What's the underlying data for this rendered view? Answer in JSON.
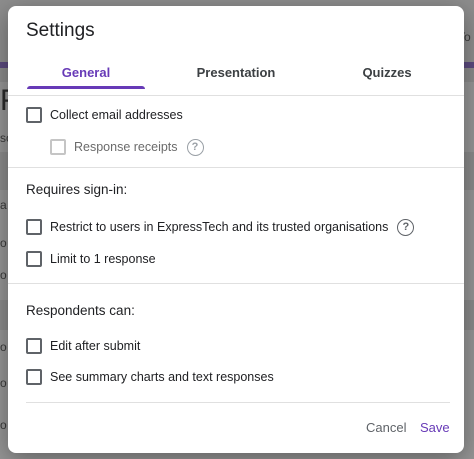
{
  "dialog": {
    "title": "Settings",
    "tabs": [
      {
        "label": "General",
        "active": true
      },
      {
        "label": "Presentation",
        "active": false
      },
      {
        "label": "Quizzes",
        "active": false
      }
    ],
    "general": {
      "collect_email": {
        "label": "Collect email addresses",
        "checked": false
      },
      "response_receipts": {
        "label": "Response receipts",
        "checked": false,
        "disabled": true
      },
      "requires_signin_heading": "Requires sign-in:",
      "restrict_users": {
        "label": "Restrict to users in ExpressTech and its trusted organisations",
        "checked": false
      },
      "limit_one": {
        "label": "Limit to 1 response",
        "checked": false
      },
      "respondents_heading": "Respondents can:",
      "edit_after_submit": {
        "label": "Edit after submit",
        "checked": false
      },
      "see_summary": {
        "label": "See summary charts and text responses",
        "checked": false
      }
    },
    "buttons": {
      "cancel": "Cancel",
      "save": "Save"
    },
    "help_icon_glyph": "?"
  },
  "background": {
    "fragments": [
      "To",
      "Fo",
      "so",
      "a",
      "o",
      "o",
      "o",
      "o",
      "o"
    ]
  },
  "colors": {
    "accent": "#673ab7",
    "scrim": "#8a8a8a"
  }
}
